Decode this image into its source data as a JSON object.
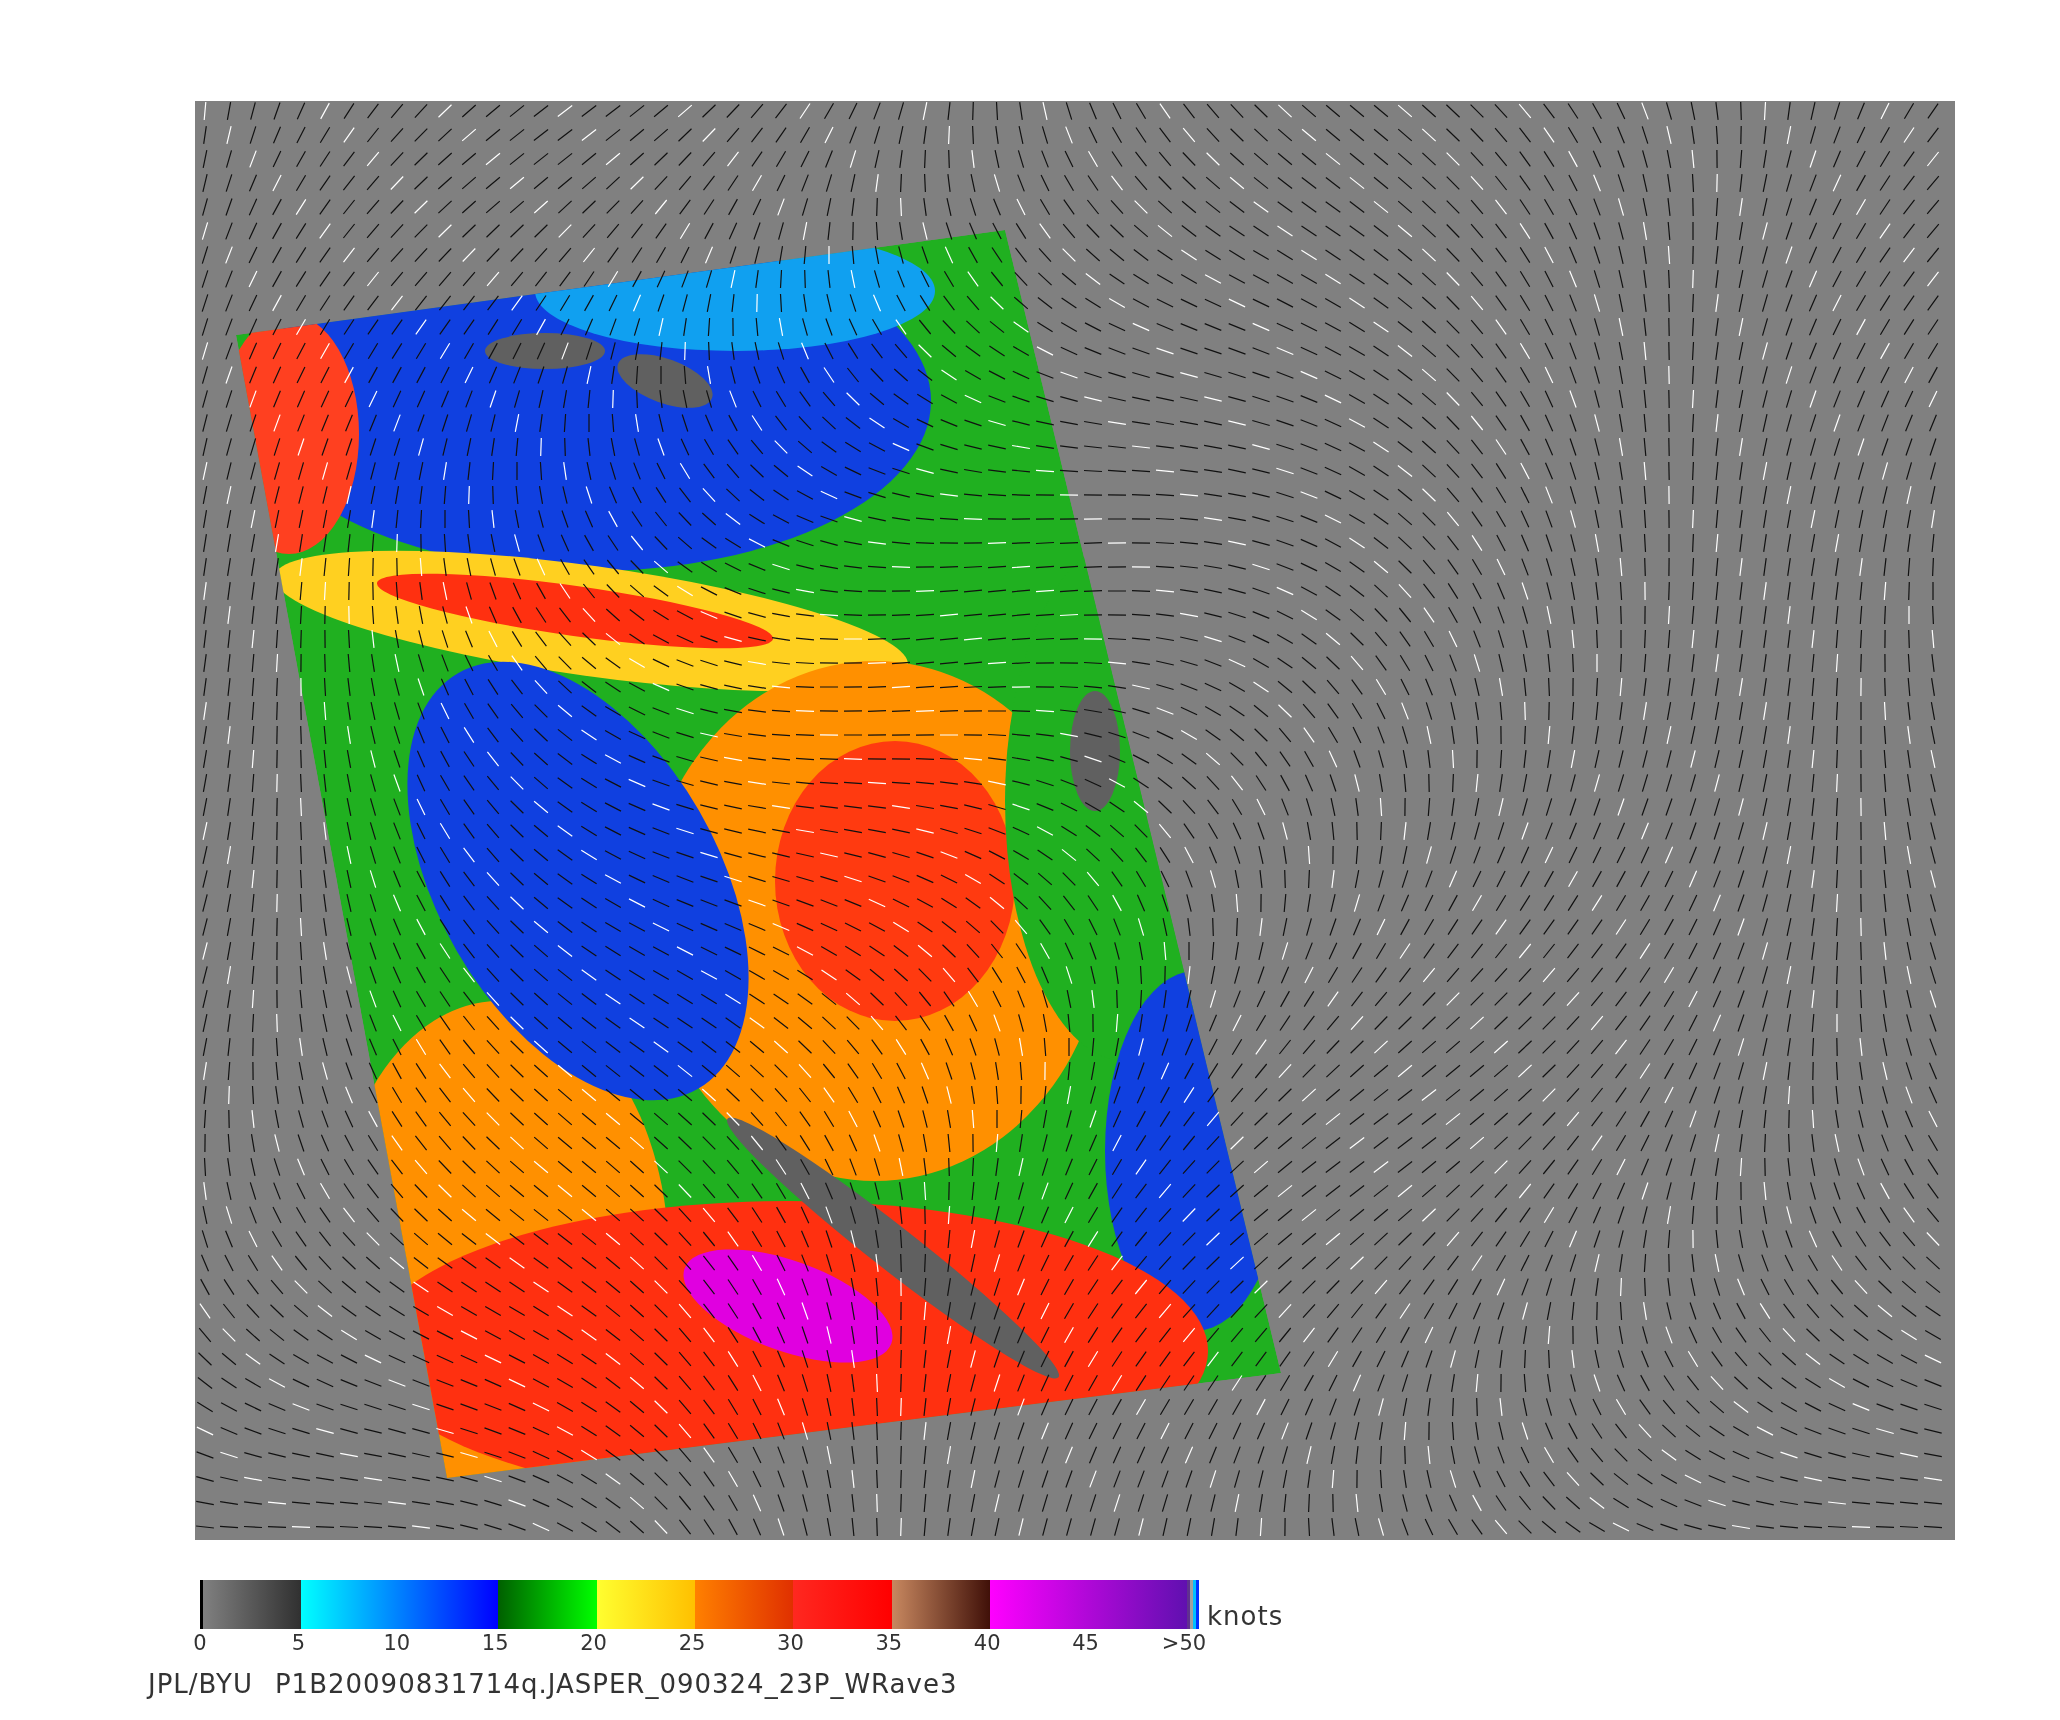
{
  "map": {
    "kind": "wind-swath"
  },
  "colorbar": {
    "unit": "knots",
    "labels": [
      "0",
      "5",
      "10",
      "15",
      "20",
      "25",
      "30",
      "35",
      "40",
      "45",
      ">50"
    ]
  },
  "footer": {
    "source": "JPL/BYU",
    "file": "P1B20090831714q.JASPER_090324_23P_WRave3"
  }
}
